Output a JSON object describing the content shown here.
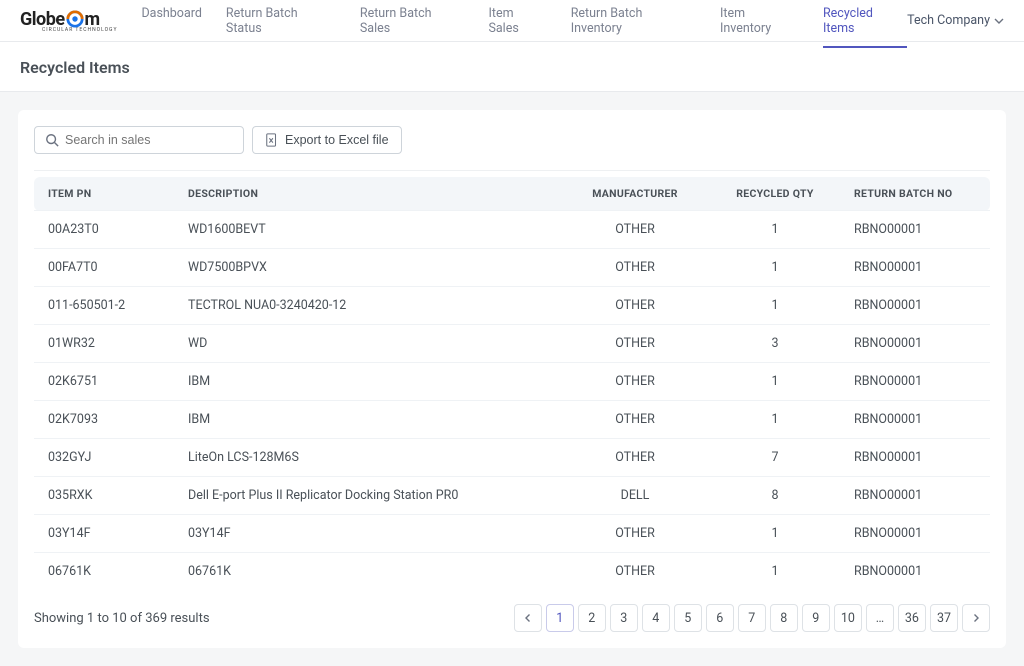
{
  "brand": {
    "name_part1": "Globe",
    "name_part2": "m",
    "tagline": "CIRCULAR TECHNOLOGY"
  },
  "nav": {
    "items": [
      {
        "label": "Dashboard",
        "active": false
      },
      {
        "label": "Return Batch Status",
        "active": false
      },
      {
        "label": "Return Batch Sales",
        "active": false
      },
      {
        "label": "Item Sales",
        "active": false
      },
      {
        "label": "Return Batch Inventory",
        "active": false
      },
      {
        "label": "Item Inventory",
        "active": false
      },
      {
        "label": "Recycled Items",
        "active": true
      }
    ],
    "company": "Tech Company"
  },
  "page": {
    "title": "Recycled Items"
  },
  "toolbar": {
    "search_placeholder": "Search in sales",
    "export_label": "Export to Excel file"
  },
  "table": {
    "headers": {
      "item_pn": "ITEM PN",
      "description": "DESCRIPTION",
      "manufacturer": "MANUFACTURER",
      "recycled_qty": "RECYCLED QTY",
      "return_batch_no": "RETURN BATCH NO"
    },
    "rows": [
      {
        "item_pn": "00A23T0",
        "description": "WD1600BEVT",
        "manufacturer": "OTHER",
        "recycled_qty": "1",
        "return_batch_no": "RBNO00001"
      },
      {
        "item_pn": "00FA7T0",
        "description": "WD7500BPVX",
        "manufacturer": "OTHER",
        "recycled_qty": "1",
        "return_batch_no": "RBNO00001"
      },
      {
        "item_pn": "011-650501-2",
        "description": "TECTROL NUA0-3240420-12",
        "manufacturer": "OTHER",
        "recycled_qty": "1",
        "return_batch_no": "RBNO00001"
      },
      {
        "item_pn": "01WR32",
        "description": "WD",
        "manufacturer": "OTHER",
        "recycled_qty": "3",
        "return_batch_no": "RBNO00001"
      },
      {
        "item_pn": "02K6751",
        "description": "IBM",
        "manufacturer": "OTHER",
        "recycled_qty": "1",
        "return_batch_no": "RBNO00001"
      },
      {
        "item_pn": "02K7093",
        "description": "IBM",
        "manufacturer": "OTHER",
        "recycled_qty": "1",
        "return_batch_no": "RBNO00001"
      },
      {
        "item_pn": "032GYJ",
        "description": "LiteOn LCS-128M6S",
        "manufacturer": "OTHER",
        "recycled_qty": "7",
        "return_batch_no": "RBNO00001"
      },
      {
        "item_pn": "035RXK",
        "description": "Dell E-port Plus II Replicator Docking Station PR0",
        "manufacturer": "DELL",
        "recycled_qty": "8",
        "return_batch_no": "RBNO00001"
      },
      {
        "item_pn": "03Y14F",
        "description": "03Y14F",
        "manufacturer": "OTHER",
        "recycled_qty": "1",
        "return_batch_no": "RBNO00001"
      },
      {
        "item_pn": "06761K",
        "description": "06761K",
        "manufacturer": "OTHER",
        "recycled_qty": "1",
        "return_batch_no": "RBNO00001"
      }
    ]
  },
  "footer": {
    "results_text": "Showing 1 to 10 of 369 results",
    "pages": [
      "1",
      "2",
      "3",
      "4",
      "5",
      "6",
      "7",
      "8",
      "9",
      "10",
      "…",
      "36",
      "37"
    ],
    "active_page": "1"
  }
}
